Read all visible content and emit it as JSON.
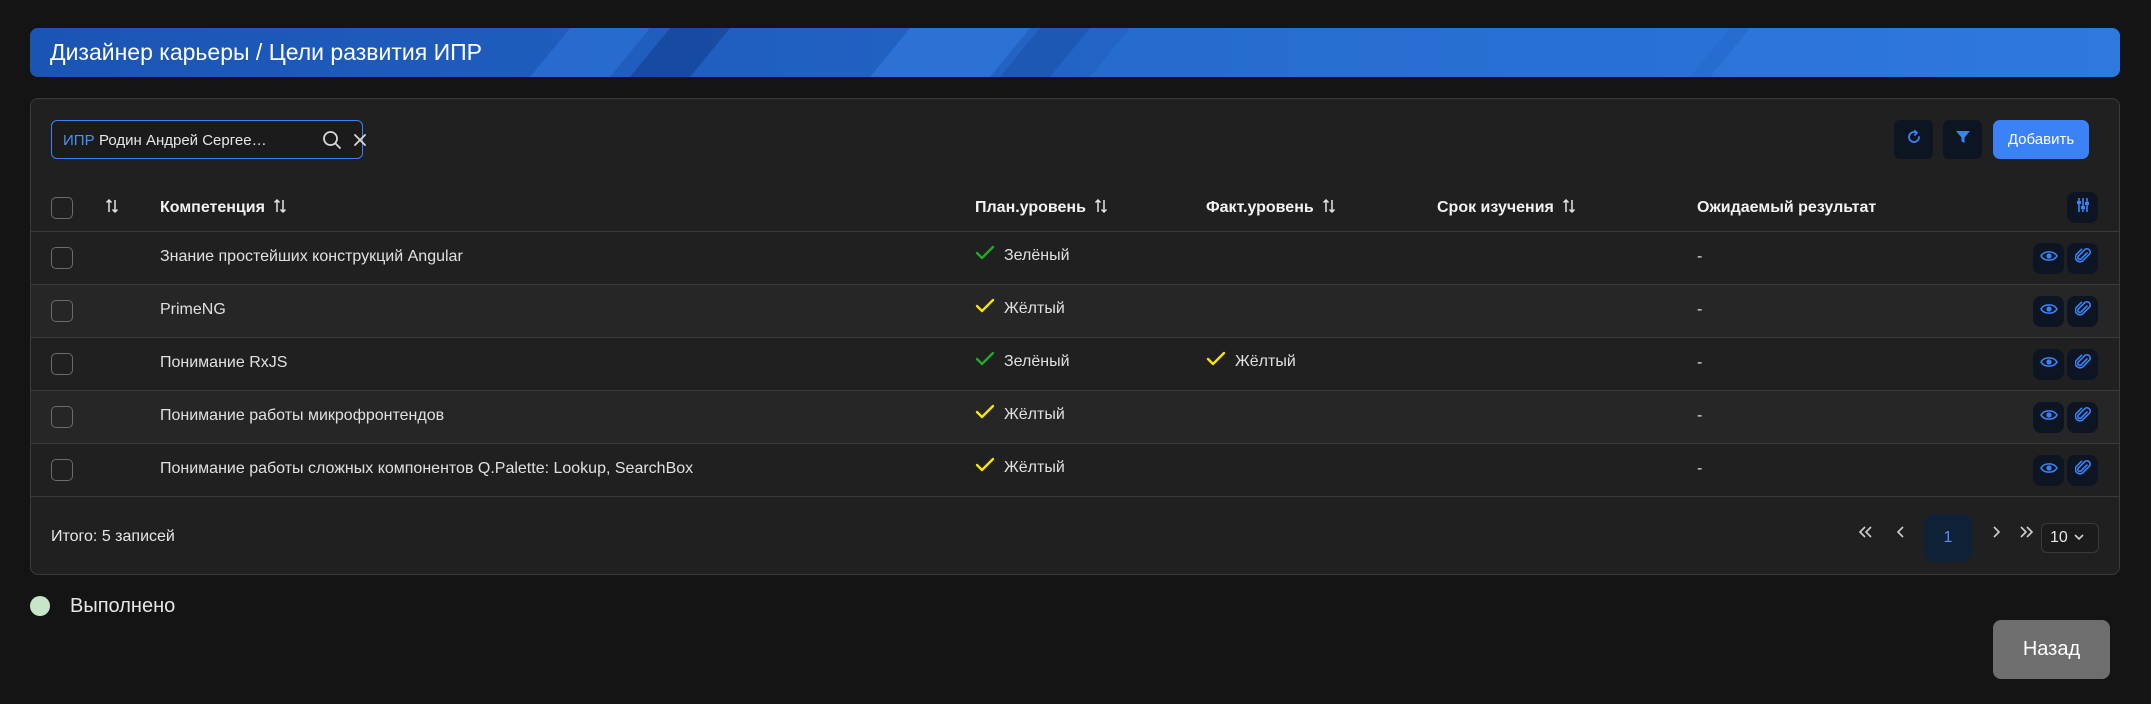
{
  "header": {
    "title": "Дизайнер карьеры / Цели развития ИПР"
  },
  "search": {
    "prefix": "ИПР",
    "value": "Родин Андрей Сергеевич"
  },
  "toolbar": {
    "add_label": "Добавить"
  },
  "table": {
    "columns": {
      "competency": "Компетенция",
      "plan_level": "План.уровень",
      "fact_level": "Факт.уровень",
      "study_term": "Срок изучения",
      "expected_result": "Ожидаемый результат"
    },
    "rows": [
      {
        "competency": "Знание простейших конструкций Angular",
        "plan_level": "Зелёный",
        "plan_color": "#1faa2b",
        "fact_level": "",
        "fact_color": "",
        "study_term": "",
        "expected_result": "-"
      },
      {
        "competency": "PrimeNG",
        "plan_level": "Жёлтый",
        "plan_color": "#f5e50a",
        "fact_level": "",
        "fact_color": "",
        "study_term": "",
        "expected_result": "-"
      },
      {
        "competency": "Понимание RxJS",
        "plan_level": "Зелёный",
        "plan_color": "#1faa2b",
        "fact_level": "Жёлтый",
        "fact_color": "#f5e50a",
        "study_term": "",
        "expected_result": "-"
      },
      {
        "competency": "Понимание работы микрофронтендов",
        "plan_level": "Жёлтый",
        "plan_color": "#f5e50a",
        "fact_level": "",
        "fact_color": "",
        "study_term": "",
        "expected_result": "-"
      },
      {
        "competency": "Понимание работы сложных компонентов Q.Palette: Lookup, SearchBox",
        "plan_level": "Жёлтый",
        "plan_color": "#f5e50a",
        "fact_level": "",
        "fact_color": "",
        "study_term": "",
        "expected_result": "-"
      }
    ]
  },
  "footer": {
    "total": "Итого: 5 записей",
    "current_page": "1",
    "rows_per_page": "10"
  },
  "legend": {
    "label": "Выполнено",
    "color": "#c7e6c9"
  },
  "actions": {
    "back_label": "Назад"
  },
  "colors": {
    "accent": "#3b82f6",
    "green": "#1faa2b",
    "yellow": "#f5e50a"
  }
}
